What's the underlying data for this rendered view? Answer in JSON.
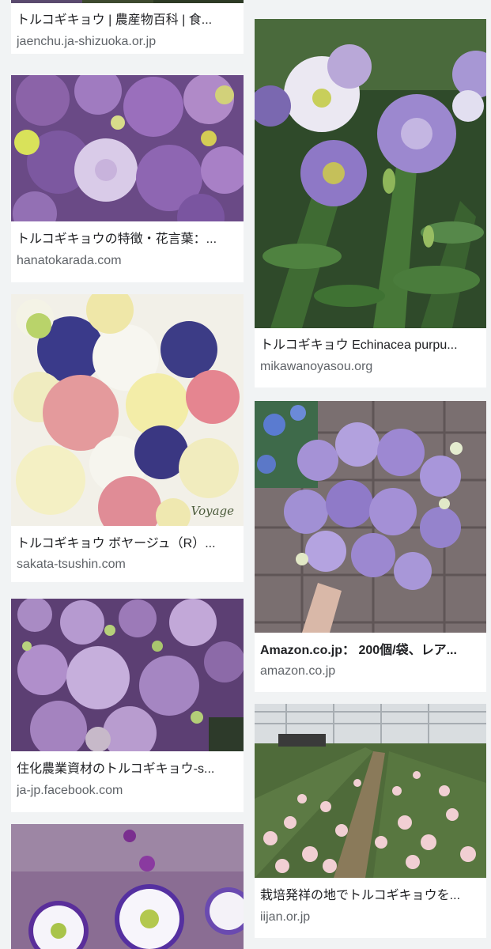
{
  "results": [
    {
      "title": "トルコギキョウ | 農産物百科 | 食...",
      "source": "jaenchu.ja-shizuoka.or.jp",
      "image": "purple-green-flowers-strip"
    },
    {
      "title": "トルコギキョウの特徴・花言葉：...",
      "source": "hanatokarada.com",
      "image": "purple-lisianthus-bouquet"
    },
    {
      "title": "トルコギキョウ ボヤージュ（R）...",
      "source": "sakata-tsushin.com",
      "image": "mixed-color-lisianthus-bouquet",
      "watermark": "Voyage"
    },
    {
      "title": "住化農業資材のトルコギキョウ-s...",
      "source": "ja-jp.facebook.com",
      "image": "purple-lisianthus-field"
    },
    {
      "title": "",
      "source": "",
      "image": "white-purple-edged-lisianthus"
    },
    {
      "title": "トルコギキョウ Echinacea purpu...",
      "source": "mikawanoyasou.org",
      "image": "lavender-white-lisianthus-plant"
    },
    {
      "title": "Amazon.co.jp： 200個/袋、レア...",
      "source": "amazon.co.jp",
      "image": "lavender-lisianthus-bouquet-in-hand"
    },
    {
      "title": "栽培発祥の地でトルコギキョウを...",
      "source": "iijan.or.jp",
      "image": "pink-lisianthus-greenhouse"
    }
  ],
  "colors": {
    "background": "#f1f3f4",
    "card": "#ffffff",
    "title": "#202124",
    "source": "#5f6368"
  }
}
